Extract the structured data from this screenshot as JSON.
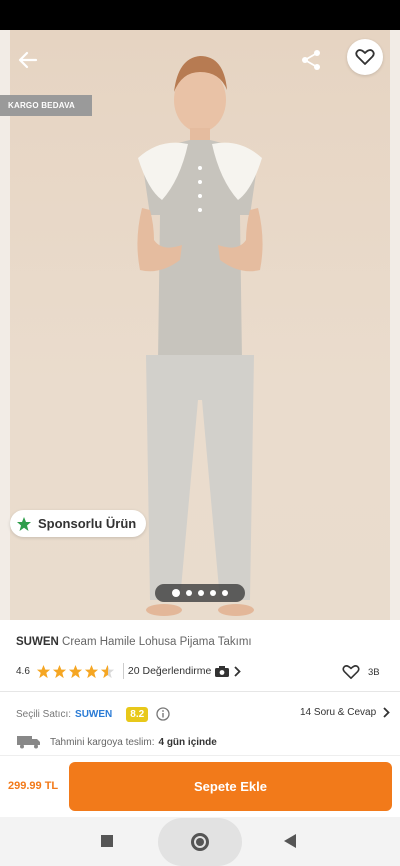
{
  "hero": {
    "badge": "KARGO BEDAVA",
    "sponsor_label": "Sponsorlu Ürün",
    "image_count": 5,
    "active_image": 1
  },
  "product": {
    "brand": "SUWEN",
    "name": "Cream Hamile Lohusa Pijama Takımı",
    "rating": "4.6",
    "reviews": "20 Değerlendirme",
    "likes": "3B"
  },
  "seller": {
    "label": "Seçili Satıcı:",
    "name": "SUWEN",
    "score": "8.2",
    "qa": "14 Soru & Cevap"
  },
  "shipping": {
    "label": "Tahmini kargoya teslim:",
    "days": "4 gün içinde"
  },
  "footer": {
    "price": "299.99 TL",
    "cart_label": "Sepete Ekle"
  },
  "colors": {
    "accent": "#f27a1a",
    "score_bg": "#e8c81a",
    "seller_link": "#2a7bd5",
    "star": "#f5a623",
    "sponsor_star": "#2e9e4b"
  },
  "icons": {
    "back": "arrow-left-icon",
    "share": "share-icon",
    "favorite": "heart-outline-icon",
    "info": "info-icon",
    "truck": "truck-icon",
    "camera": "camera-icon"
  }
}
